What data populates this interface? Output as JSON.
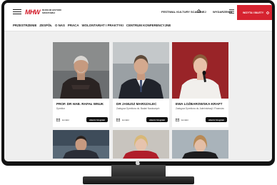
{
  "header": {
    "logo_mark": "MHW",
    "logo_line1": "MUZEUM HISTORII",
    "logo_line2": "ŚWIATOWEJ",
    "festival_label": "FESTIWAL KULTURY SCALONEJ",
    "exhibitions_label": "WYDARZENIA",
    "visit_label": "WIZYTA I BILETY"
  },
  "nav": {
    "items": [
      "PRZESTRZENIE",
      "ZESPÓŁ",
      "O NAS",
      "PRACA",
      "WOLONTARIAT I PRAKTYKI",
      "CENTRUM KONFERENCYJNE"
    ]
  },
  "staff": [
    {
      "name": "PROF. DR HAB. RAFAŁ WNUK",
      "role": "Dyrektor",
      "contact_label": "kontakt",
      "bio_label": "otwórz biogram"
    },
    {
      "name": "DR JANUSZ MARSZALEC",
      "role": "Zastępca Dyrektora ds. Badań Naukowych",
      "contact_label": "kontakt",
      "bio_label": "otwórz biogram"
    },
    {
      "name": "EWA LOŻBAROWSKA-KRAFT",
      "role": "Zastępca Dyrektora ds. Administracji i Finansów",
      "contact_label": "kontakt",
      "bio_label": "otwórz biogram"
    }
  ],
  "colors": {
    "brand_red": "#d62330",
    "screen_bg": "#efefef",
    "button_dark": "#111111"
  }
}
